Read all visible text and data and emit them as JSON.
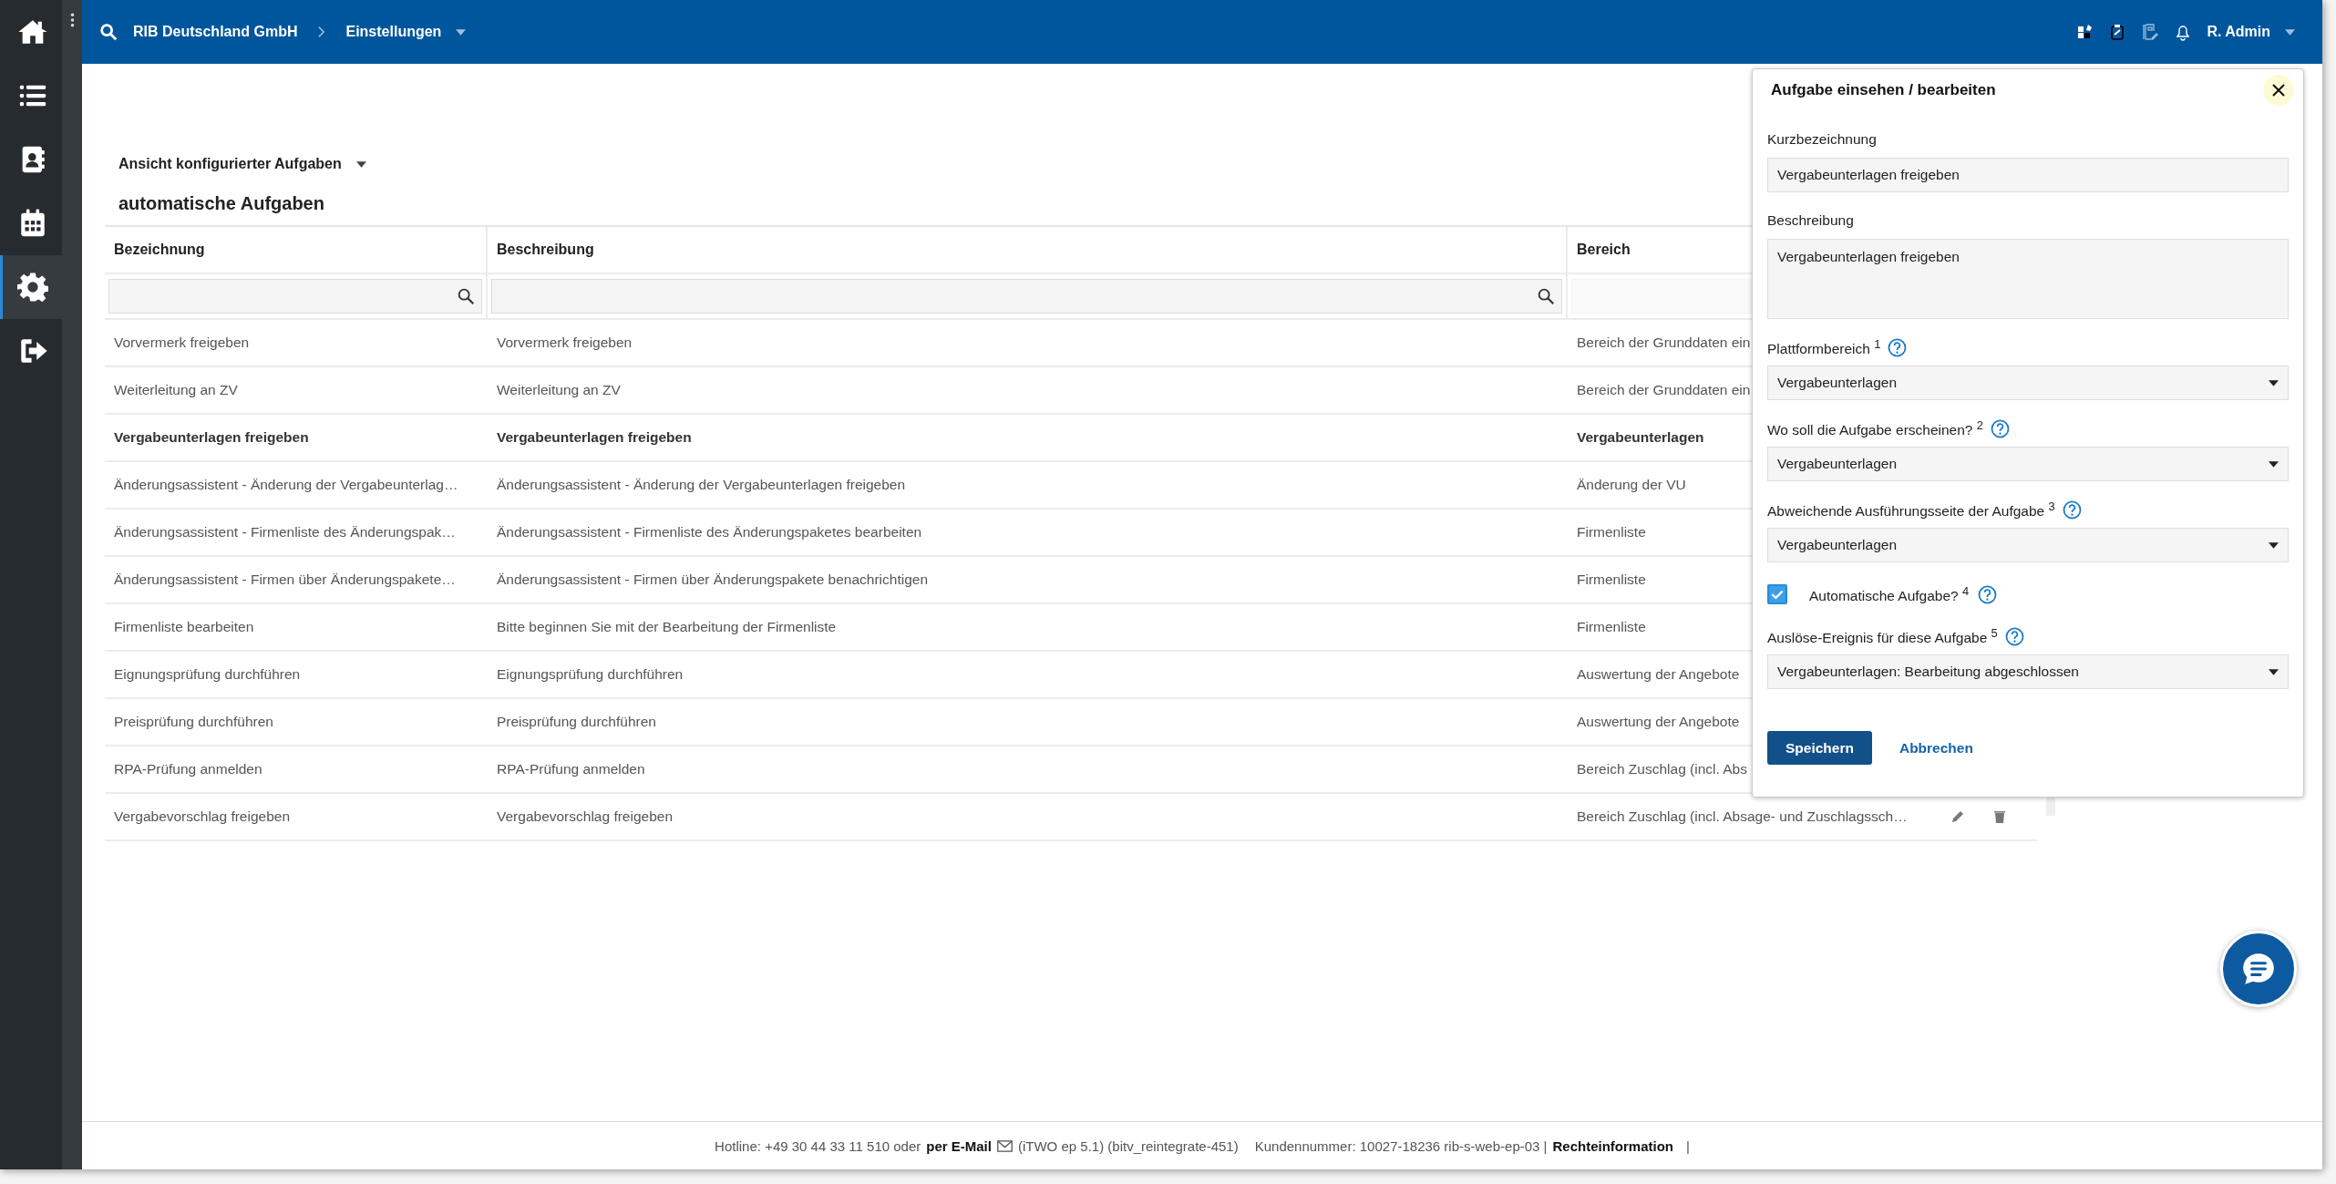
{
  "sidebar": {
    "items": [
      {
        "selected": false
      },
      {
        "selected": false
      },
      {
        "selected": false
      },
      {
        "selected": false
      },
      {
        "selected": true
      },
      {
        "selected": false
      }
    ]
  },
  "top_bar": {
    "breadcrumb": [
      "RIB Deutschland GmbH",
      "Einstellungen"
    ],
    "user": "R. Admin"
  },
  "view_selector": {
    "label": "Ansicht konfigurierter Aufgaben"
  },
  "section_title": "automatische Aufgaben",
  "table": {
    "columns": [
      "Bezeichnung",
      "Beschreibung",
      "Bereich"
    ],
    "filters": [
      {
        "kind": "search"
      },
      {
        "kind": "search"
      },
      {
        "kind": "plain"
      }
    ],
    "rows": [
      {
        "selected": false,
        "cells": [
          "Vorvermerk freigeben",
          "Vorvermerk freigeben",
          "Bereich der Grunddaten ein"
        ]
      },
      {
        "selected": false,
        "cells": [
          "Weiterleitung an ZV",
          "Weiterleitung an ZV",
          "Bereich der Grunddaten ein"
        ]
      },
      {
        "selected": true,
        "cells": [
          "Vergabeunterlagen freigeben",
          "Vergabeunterlagen freigeben",
          "Vergabeunterlagen"
        ]
      },
      {
        "selected": false,
        "cells": [
          "Änderungsassistent - Änderung der Vergabeunterlag…",
          "Änderungsassistent - Änderung der Vergabeunterlagen freigeben",
          "Änderung der VU"
        ]
      },
      {
        "selected": false,
        "cells": [
          "Änderungsassistent - Firmenliste des Änderungspak…",
          "Änderungsassistent - Firmenliste des Änderungspaketes bearbeiten",
          "Firmenliste"
        ]
      },
      {
        "selected": false,
        "cells": [
          "Änderungsassistent - Firmen über Änderungspakete…",
          "Änderungsassistent - Firmen über Änderungspakete benachrichtigen",
          "Firmenliste"
        ]
      },
      {
        "selected": false,
        "cells": [
          "Firmenliste bearbeiten",
          "Bitte beginnen Sie mit der Bearbeitung der Firmenliste",
          "Firmenliste"
        ]
      },
      {
        "selected": false,
        "cells": [
          "Eignungsprüfung durchführen",
          "Eignungsprüfung durchführen",
          "Auswertung der Angebote"
        ]
      },
      {
        "selected": false,
        "cells": [
          "Preisprüfung durchführen",
          "Preisprüfung durchführen",
          "Auswertung der Angebote"
        ]
      },
      {
        "selected": false,
        "cells": [
          "RPA-Prüfung anmelden",
          "RPA-Prüfung anmelden",
          "Bereich Zuschlag (incl. Abs"
        ]
      },
      {
        "selected": false,
        "cells": [
          "Vergabevorschlag freigeben",
          "Vergabevorschlag freigeben",
          "Bereich Zuschlag (incl. Absage- und Zuschlagssch…"
        ]
      }
    ]
  },
  "dialog": {
    "title": "Aufgabe einsehen / bearbeiten",
    "fields": [
      {
        "kind": "text",
        "label": "Kurzbezeichnung",
        "help": false,
        "value": "Vergabeunterlagen freigeben"
      },
      {
        "kind": "textarea",
        "label": "Beschreibung",
        "help": false,
        "value": "Vergabeunterlagen freigeben"
      },
      {
        "kind": "select",
        "label": "Plattformbereich $^{1}$",
        "help": true,
        "value": "Vergabeunterlagen"
      },
      {
        "kind": "select",
        "label": "Wo soll die Aufgabe erscheinen? $^{2}$",
        "help": true,
        "value": "Vergabeunterlagen"
      },
      {
        "kind": "select",
        "label": "Abweichende Ausführungsseite der Aufgabe $^{3}$",
        "help": true,
        "value": "Vergabeunterlagen"
      },
      {
        "kind": "checkbox",
        "label": "Automatische Aufgabe? $^{4}$",
        "help": true,
        "checked": true
      },
      {
        "kind": "select",
        "label": "Auslöse-Ereignis für diese Aufgabe $^{5}$",
        "help": true,
        "value": "Vergabeunterlagen: Bearbeitung abgeschlossen"
      }
    ],
    "buttons": [
      {
        "kind": "primary",
        "label": "Speichern"
      },
      {
        "kind": "link",
        "label": "Abbrechen"
      }
    ]
  },
  "footer": {
    "hotline": "Hotline: +49 30 44 33 11 510 oder",
    "email_link": "per E-Mail",
    "version": "(iTWO ep 5.1) (bitv_reintegrate-451)",
    "customer": "Kundennummer: 10027-18236 rib-s-web-ep-03 |",
    "legal_link": "Rechteinformation",
    "separator": "|"
  }
}
